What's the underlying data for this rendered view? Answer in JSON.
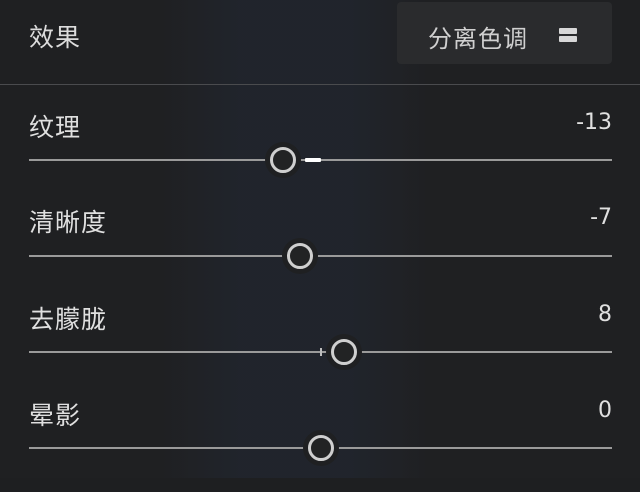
{
  "header": {
    "title": "效果",
    "split_toning_label": "分离色调",
    "split_toning_icon": "split-panel-icon"
  },
  "sliders": [
    {
      "label": "纹理",
      "value": "-13",
      "fraction": 0.435
    },
    {
      "label": "清晰度",
      "value": "-7",
      "fraction": 0.465
    },
    {
      "label": "去朦胧",
      "value": "8",
      "fraction": 0.54
    },
    {
      "label": "晕影",
      "value": "0",
      "fraction": 0.5
    }
  ],
  "colors": {
    "background": "#1f2022",
    "button": "#2a2b2d",
    "track": "#9a9a9a",
    "thumb_border": "#cfcfcf"
  }
}
